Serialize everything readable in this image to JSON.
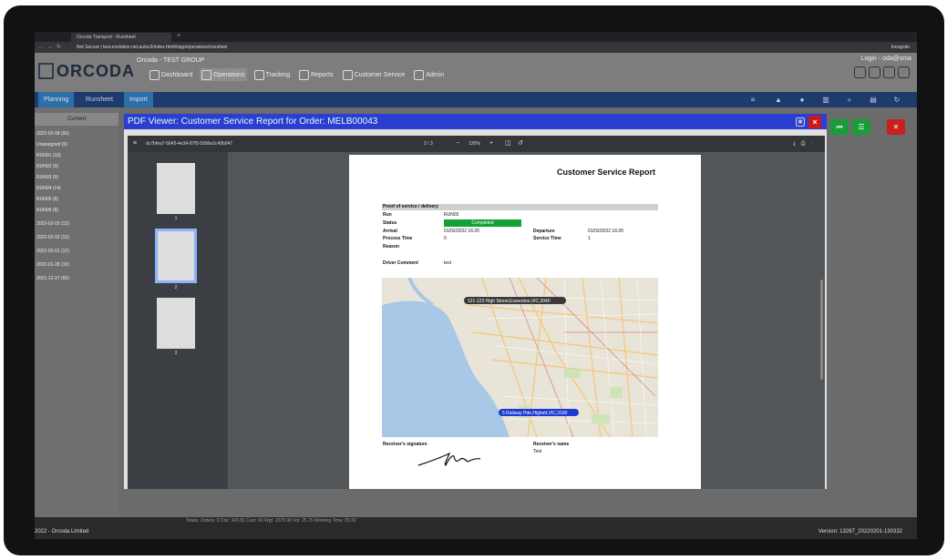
{
  "browser": {
    "tab_title": "Orcoda Transport - Runsheet",
    "new_tab": "+",
    "url": "Not Secure | test.esolution.net.au/ex3/index.html#/app/operations/runsheet",
    "profile": "Incognito"
  },
  "app": {
    "logo": "ORCODA",
    "group": "Orcoda - TEST GROUP",
    "login": "Login - oda@sma",
    "menu": [
      "Dashboard",
      "Operations",
      "Tracking",
      "Reports",
      "Customer Service",
      "Admin"
    ]
  },
  "nav": {
    "tabs": [
      "Planning",
      "Runsheet",
      "Import"
    ]
  },
  "sidebar": {
    "current": "Current",
    "rows": [
      "2022-02-08 (60)",
      "Unassigned (0)",
      "RUN01 (10)",
      "RUN02 (9)",
      "RUN03 (9)",
      "RUN04 (14)",
      "RUN05 (8)",
      "RUN06 (8)",
      "2022-02-03 (12)",
      "2022-02-02 (12)",
      "2022-02-01 (12)",
      "2022-01-28 (10)",
      "2021-12-27 (60)"
    ]
  },
  "modal": {
    "title": "PDF Viewer: Customer Service Report for Order: MELB00043",
    "close": "×",
    "save": "▣"
  },
  "pdf": {
    "filename": "dc7bfea7-5645-4e34-87f0-5006e2c49b047",
    "page_indicator": "2 / 3",
    "zoom": "120%",
    "thumbnails": [
      "1",
      "2",
      "3"
    ]
  },
  "report": {
    "title": "Customer Service Report",
    "section": "Proof of service / delivery",
    "run_label": "Run",
    "run_value": "RUN02",
    "status_label": "Status",
    "status_value": "Completed",
    "arrival_label": "Arrival",
    "arrival_value": "01/02/2022 16:20",
    "departure_label": "Departure",
    "departure_value": "01/02/2022 16:20",
    "process_label": "Process Time",
    "process_value": "0",
    "service_label": "Service Time",
    "service_value": "1",
    "reason_label": "Reason",
    "comment_label": "Driver Comment",
    "comment_value": "test",
    "map_label_1": "121-123 High Street,Essendon,VIC,3040",
    "map_label_2": "5 Railway Pde,Highett,VIC,3190",
    "sig_label": "Receiver's signature",
    "name_label": "Receiver's name",
    "name_value": "Test"
  },
  "footer": {
    "totals": "Totals: Orders: 9 Dist: 343.81 Cost: 60 Wgt: 2078.98 Vol: 25.75 Working Time: 05:32",
    "copyright": "2022 - Orcoda Limited",
    "version": "Version: 13267_20220201-130332"
  },
  "colors": {
    "header": "#7d7d7d",
    "navbar": "#1e3b6d",
    "modal_title": "#2a3ed1",
    "completed": "#11a134",
    "close": "#c81a1a"
  }
}
